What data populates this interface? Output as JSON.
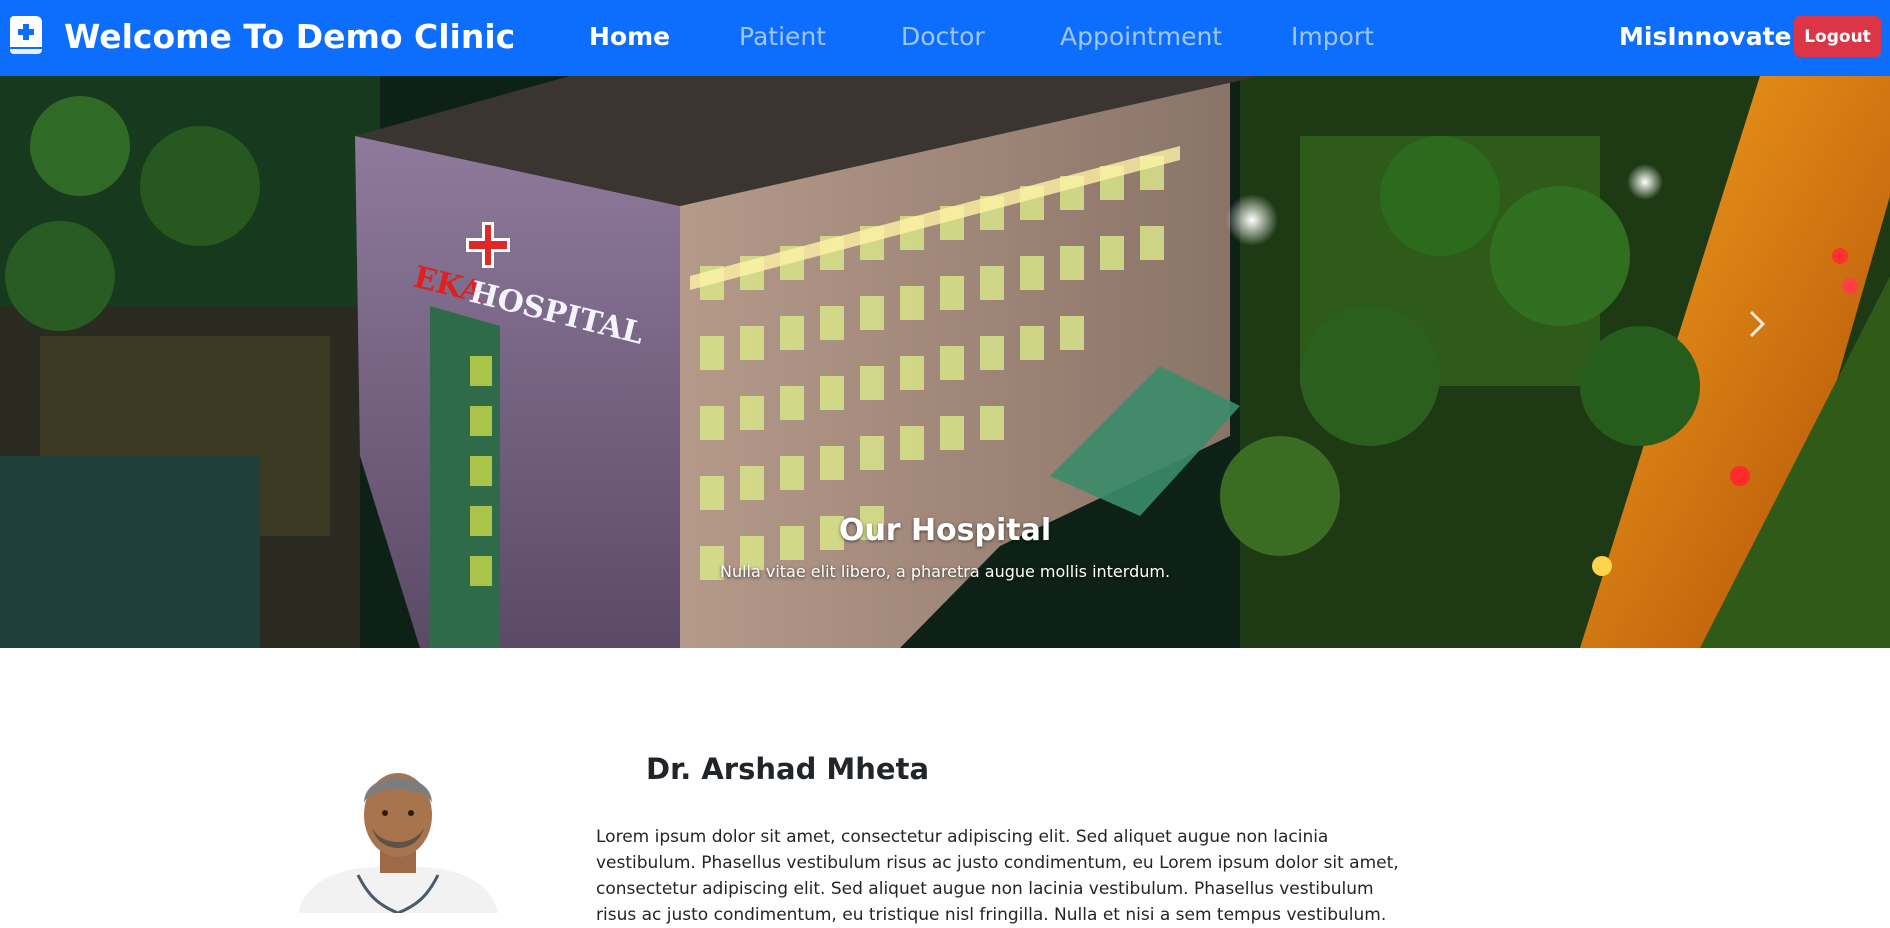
{
  "navbar": {
    "brand_title": "Welcome To Demo Clinic",
    "brand_icon": "medical-book-icon",
    "links": [
      {
        "label": "Home",
        "active": true
      },
      {
        "label": "Patient",
        "active": false
      },
      {
        "label": "Doctor",
        "active": false
      },
      {
        "label": "Appointment",
        "active": false
      },
      {
        "label": "Import",
        "active": false
      }
    ],
    "user": "MisInnovate",
    "logout_label": "Logout",
    "colors": {
      "bar": "#0d6efd",
      "logout": "#dc3545"
    }
  },
  "carousel": {
    "image": "hospital-night-aerial",
    "sign_text": "EKA HOSPITAL",
    "caption_title": "Our Hospital",
    "caption_text": "Nulla vitae elit libero, a pharetra augue mollis interdum.",
    "next_icon": "chevron-right-icon",
    "prev_icon": "chevron-left-icon"
  },
  "doctor": {
    "name": "Dr. Arshad Mheta",
    "photo": "doctor-portrait",
    "bio": "Lorem ipsum dolor sit amet, consectetur adipiscing elit. Sed aliquet augue non lacinia vestibulum. Phasellus vestibulum risus ac justo condimentum, eu Lorem ipsum dolor sit amet, consectetur adipiscing elit. Sed aliquet augue non lacinia vestibulum. Phasellus vestibulum risus ac justo condimentum, eu tristique nisl fringilla. Nulla et nisi a sem tempus vestibulum."
  }
}
